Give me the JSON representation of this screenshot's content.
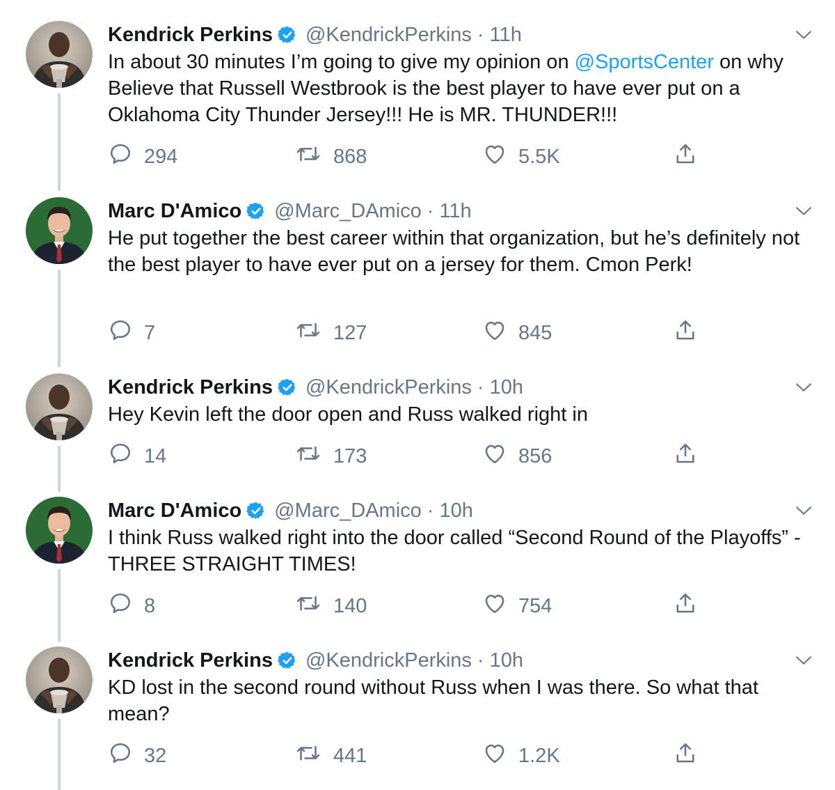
{
  "colors": {
    "accent": "#1da1f2",
    "muted": "#657786",
    "text": "#14171a",
    "line": "#ccd6dd"
  },
  "tweets": [
    {
      "name": "Kendrick Perkins",
      "handle": "@KendrickPerkins",
      "time": "11h",
      "text_before": "In about 30 minutes I’m going to give my opinion on ",
      "mention": "@SportsCenter",
      "text_after": " on why Believe that Russell Westbrook is the best player to have ever put on a Oklahoma City Thunder Jersey!!! He is MR. THUNDER!!!",
      "replies": "294",
      "retweets": "868",
      "likes": "5.5K",
      "avatar": "perkins"
    },
    {
      "name": "Marc D'Amico",
      "handle": "@Marc_DAmico",
      "time": "11h",
      "text_before": "He put together the best career within that organization, but he’s definitely not the best player to have ever put on a jersey for them. Cmon Perk!",
      "mention": "",
      "text_after": "",
      "replies": "7",
      "retweets": "127",
      "likes": "845",
      "avatar": "damico"
    },
    {
      "name": "Kendrick Perkins",
      "handle": "@KendrickPerkins",
      "time": "10h",
      "text_before": "Hey Kevin left the door open and Russ walked right in",
      "mention": "",
      "text_after": "",
      "replies": "14",
      "retweets": "173",
      "likes": "856",
      "avatar": "perkins"
    },
    {
      "name": "Marc D'Amico",
      "handle": "@Marc_DAmico",
      "time": "10h",
      "text_before": "I think Russ walked right into the door called “Second Round of the Playoffs” - THREE STRAIGHT TIMES!",
      "mention": "",
      "text_after": "",
      "replies": "8",
      "retweets": "140",
      "likes": "754",
      "avatar": "damico"
    },
    {
      "name": "Kendrick Perkins",
      "handle": "@KendrickPerkins",
      "time": "10h",
      "text_before": "KD lost in the second round without Russ when I was there. So what that mean?",
      "mention": "",
      "text_after": "",
      "replies": "32",
      "retweets": "441",
      "likes": "1.2K",
      "avatar": "perkins"
    }
  ]
}
